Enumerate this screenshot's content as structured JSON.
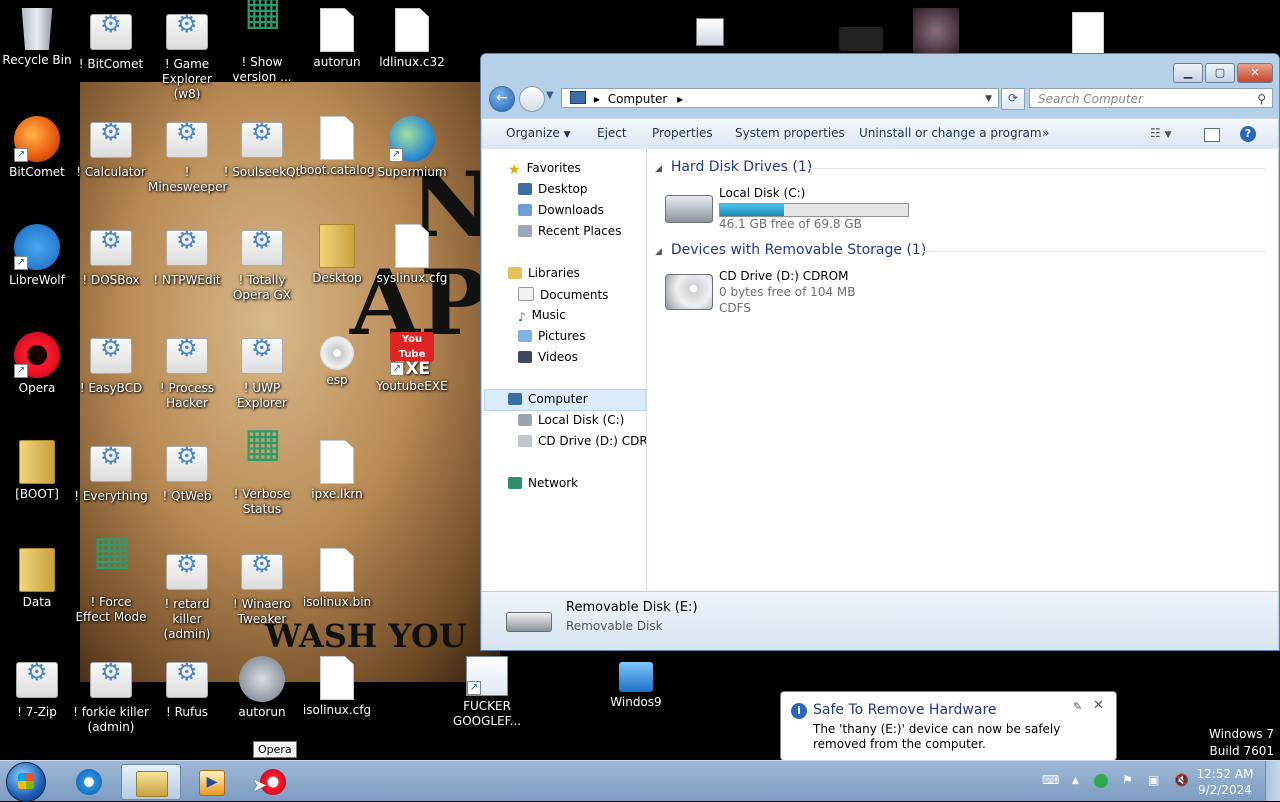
{
  "desktop": {
    "icons": [
      {
        "label": "Recycle Bin"
      },
      {
        "label": "! BitComet"
      },
      {
        "label": "! Game Explorer (w8)"
      },
      {
        "label": "! Show version ..."
      },
      {
        "label": "autorun"
      },
      {
        "label": "ldlinux.c32"
      },
      {
        "label": "BitComet"
      },
      {
        "label": "! Calculator"
      },
      {
        "label": "! Minesweeper"
      },
      {
        "label": "! SoulseekQt"
      },
      {
        "label": "boot.catalog"
      },
      {
        "label": "Supermium"
      },
      {
        "label": "LibreWolf"
      },
      {
        "label": "! DOSBox"
      },
      {
        "label": "! NTPWEdit"
      },
      {
        "label": "! Totally Opera GX"
      },
      {
        "label": "Desktop"
      },
      {
        "label": "syslinux.cfg"
      },
      {
        "label": "Opera"
      },
      {
        "label": "! EasyBCD"
      },
      {
        "label": "! Process Hacker"
      },
      {
        "label": "! UWP Explorer"
      },
      {
        "label": "esp"
      },
      {
        "label": "YoutubeEXE"
      },
      {
        "label": "[BOOT]"
      },
      {
        "label": "! Everything"
      },
      {
        "label": "! QtWeb"
      },
      {
        "label": "! Verbose Status"
      },
      {
        "label": "ipxe.lkrn"
      },
      {
        "label": "Data"
      },
      {
        "label": "! Force Effect Mode"
      },
      {
        "label": "! retard killer (admin)"
      },
      {
        "label": "! Winaero Tweaker"
      },
      {
        "label": "isolinux.bin"
      },
      {
        "label": "! 7-Zip"
      },
      {
        "label": "! forkie killer (admin)"
      },
      {
        "label": "! Rufus"
      },
      {
        "label": "autorun"
      },
      {
        "label": "isolinux.cfg"
      },
      {
        "label": "FUCKER GOOGLEF..."
      },
      {
        "label": "Windos9"
      }
    ],
    "wallpaper_text": [
      "N",
      "AP",
      "WASH YOU"
    ],
    "youtube_logo": "You Tube",
    "youtube_exe": "EXE",
    "watermark": {
      "line1": "Windows 7",
      "line2": "Build 7601"
    }
  },
  "window": {
    "address": {
      "path": "Computer",
      "icon": "computer-icon"
    },
    "search_placeholder": "Search Computer",
    "toolbar": {
      "organize": "Organize",
      "eject": "Eject",
      "properties": "Properties",
      "system_properties": "System properties",
      "uninstall": "Uninstall or change a program",
      "more": "»"
    },
    "nav": {
      "favorites": "Favorites",
      "desktop": "Desktop",
      "downloads": "Downloads",
      "recent": "Recent Places",
      "libraries": "Libraries",
      "documents": "Documents",
      "music": "Music",
      "pictures": "Pictures",
      "videos": "Videos",
      "computer": "Computer",
      "local_disk": "Local Disk (C:)",
      "cd_drive": "CD Drive (D:) CDROM",
      "network": "Network"
    },
    "groups": {
      "hdd": "Hard Disk Drives (1)",
      "removable": "Devices with Removable Storage (1)"
    },
    "drives": {
      "c": {
        "name": "Local Disk (C:)",
        "free": "46.1 GB free of 69.8 GB",
        "used_fraction": 0.34
      },
      "d": {
        "name": "CD Drive (D:) CDROM",
        "free": "0 bytes free of 104 MB",
        "fs": "CDFS"
      }
    },
    "details": {
      "name": "Removable Disk (E:)",
      "type": "Removable Disk"
    }
  },
  "notification": {
    "title": "Safe To Remove Hardware",
    "message": "The 'thany (E:)' device can now be safely removed from the computer."
  },
  "taskbar": {
    "tooltip": "Opera",
    "clock": {
      "time": "12:52 AM",
      "date": "9/2/2024"
    }
  },
  "colors": {
    "accent": "#1e3a8a",
    "taskbar": "#7d9cc2",
    "disk_bar": "#1d8ab8"
  }
}
